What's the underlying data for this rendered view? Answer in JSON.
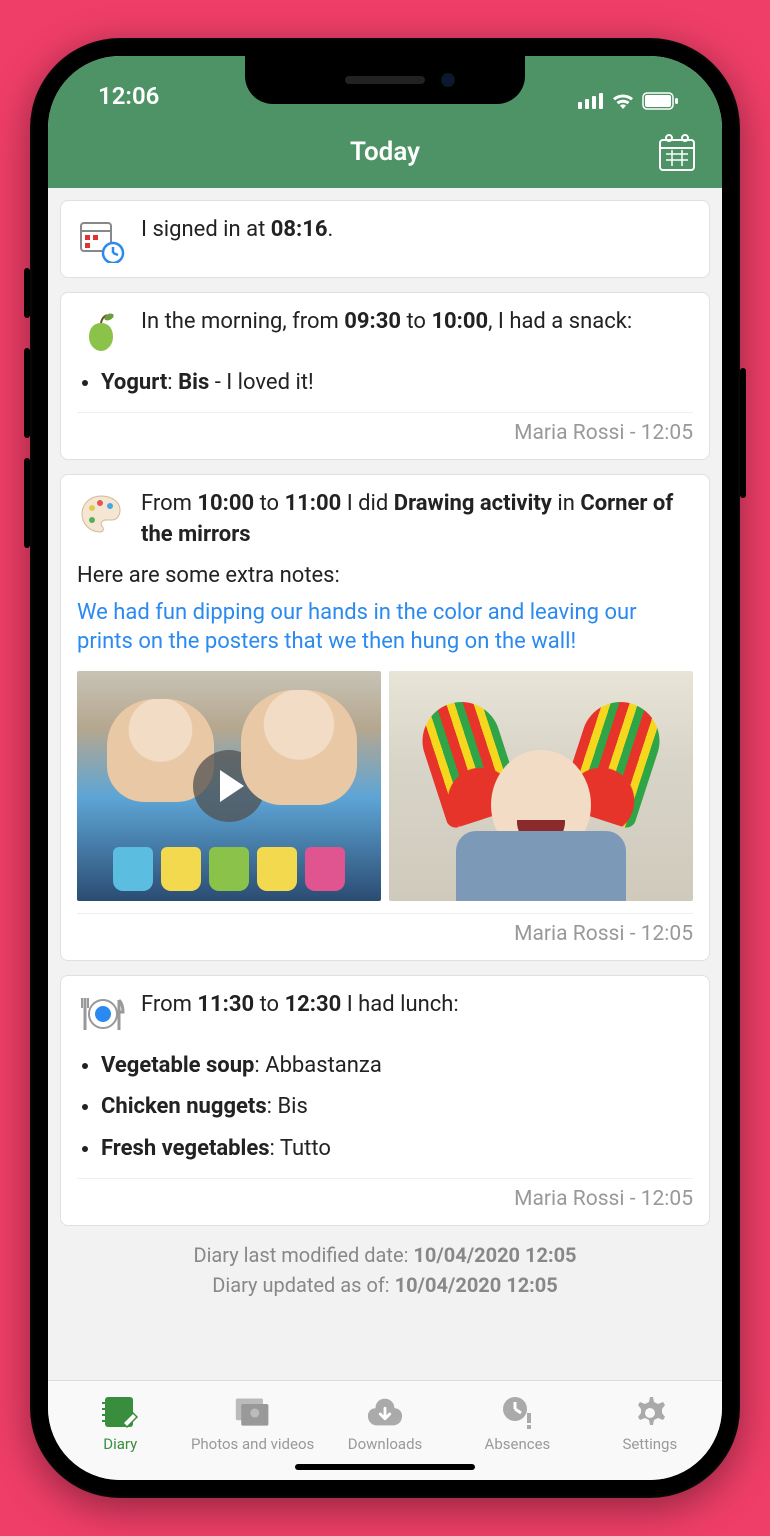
{
  "status": {
    "time": "12:06"
  },
  "header": {
    "title": "Today"
  },
  "signin": {
    "prefix": "I signed in at ",
    "time": "08:16",
    "suffix": "."
  },
  "snack": {
    "line_prefix": "In the morning, from ",
    "from": "09:30",
    "mid": " to ",
    "to": "10:00",
    "suffix": ", I had a snack:",
    "item_food": "Yogurt",
    "item_qty": "Bis",
    "item_note": " - I loved it!",
    "author": "Maria Rossi - 12:05"
  },
  "activity": {
    "prefix": "From ",
    "from": "10:00",
    "mid": " to ",
    "to": "11:00",
    "mid2": " I did ",
    "name": "Drawing activity",
    "mid3": " in ",
    "place": "Corner of the mirrors",
    "notes_label": "Here are some extra notes:",
    "notes_text": "We had fun dipping our hands in the color and leaving our prints on the posters that we then hung on the wall!",
    "author": "Maria Rossi - 12:05"
  },
  "lunch": {
    "prefix": "From ",
    "from": "11:30",
    "mid": " to ",
    "to": "12:30",
    "suffix": " I had lunch:",
    "items": [
      {
        "food": "Vegetable soup",
        "qty": "Abbastanza"
      },
      {
        "food": "Chicken nuggets",
        "qty": "Bis"
      },
      {
        "food": "Fresh vegetables",
        "qty": "Tutto"
      }
    ],
    "author": "Maria Rossi - 12:05"
  },
  "summary": {
    "line1_label": "Diary last modified date: ",
    "line1_val": "10/04/2020 12:05",
    "line2_label": "Diary updated as of: ",
    "line2_val": "10/04/2020 12:05"
  },
  "tabs": {
    "diary": "Diary",
    "photos": "Photos and videos",
    "downloads": "Downloads",
    "absences": "Absences",
    "settings": "Settings"
  }
}
